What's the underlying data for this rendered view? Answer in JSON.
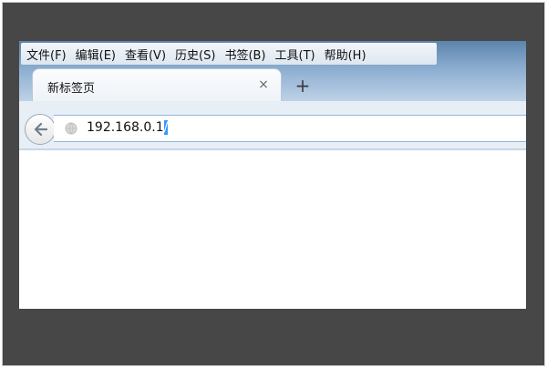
{
  "menu": [
    {
      "label": "文件(F)"
    },
    {
      "label": "编辑(E)"
    },
    {
      "label": "查看(V)"
    },
    {
      "label": "历史(S)"
    },
    {
      "label": "书签(B)"
    },
    {
      "label": "工具(T)"
    },
    {
      "label": "帮助(H)"
    }
  ],
  "tab": {
    "title": "新标签页",
    "close_glyph": "×"
  },
  "new_tab_glyph": "+",
  "address": {
    "text": "192.168.0.1",
    "selected": "/"
  },
  "colors": {
    "url_selection": "#3399ff",
    "url_border": "#8fb6d8",
    "frame": "#474747"
  }
}
